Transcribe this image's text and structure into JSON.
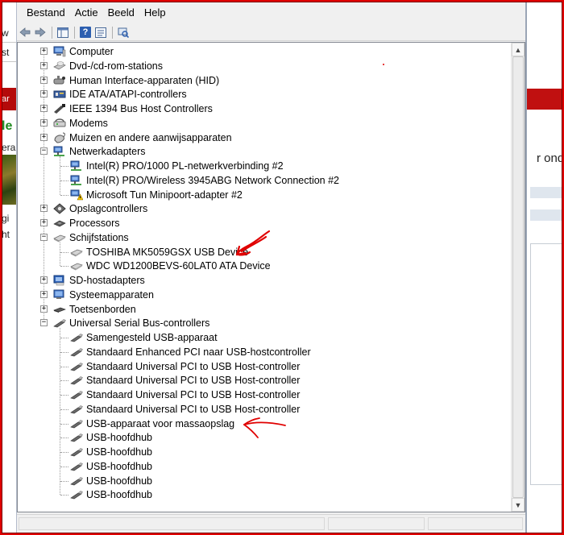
{
  "menu": [
    "Bestand",
    "Actie",
    "Beeld",
    "Help"
  ],
  "toolbar": {
    "buttons": [
      "back-arrow-icon",
      "forward-arrow-icon",
      "console-tree-icon",
      "help-icon",
      "properties-icon",
      "scan-hardware-icon"
    ],
    "help_label": "?"
  },
  "tree": {
    "items": [
      {
        "label": "Computer",
        "level": 1,
        "expander": "+",
        "icon": "computer-icon"
      },
      {
        "label": "Dvd-/cd-rom-stations",
        "level": 1,
        "expander": "+",
        "icon": "dvd-drive-icon"
      },
      {
        "label": "Human Interface-apparaten (HID)",
        "level": 1,
        "expander": "+",
        "icon": "hid-icon"
      },
      {
        "label": "IDE ATA/ATAPI-controllers",
        "level": 1,
        "expander": "+",
        "icon": "ide-controller-icon"
      },
      {
        "label": "IEEE 1394 Bus Host Controllers",
        "level": 1,
        "expander": "+",
        "icon": "ieee1394-icon"
      },
      {
        "label": "Modems",
        "level": 1,
        "expander": "+",
        "icon": "modem-icon"
      },
      {
        "label": "Muizen en andere aanwijsapparaten",
        "level": 1,
        "expander": "+",
        "icon": "mouse-icon"
      },
      {
        "label": "Netwerkadapters",
        "level": 1,
        "expander": "−",
        "icon": "network-adapter-icon"
      },
      {
        "label": "Intel(R) PRO/1000 PL-netwerkverbinding #2",
        "level": 2,
        "icon": "network-adapter-icon"
      },
      {
        "label": "Intel(R) PRO/Wireless 3945ABG Network Connection #2",
        "level": 2,
        "icon": "network-adapter-icon"
      },
      {
        "label": "Microsoft Tun Minipoort-adapter #2",
        "level": 2,
        "icon": "network-warning-icon"
      },
      {
        "label": "Opslagcontrollers",
        "level": 1,
        "expander": "+",
        "icon": "storage-controller-icon"
      },
      {
        "label": "Processors",
        "level": 1,
        "expander": "+",
        "icon": "processor-icon"
      },
      {
        "label": "Schijfstations",
        "level": 1,
        "expander": "−",
        "icon": "disk-drive-icon"
      },
      {
        "label": "TOSHIBA MK5059GSX USB Device",
        "level": 2,
        "icon": "disk-drive-icon"
      },
      {
        "label": "WDC WD1200BEVS-60LAT0 ATA Device",
        "level": 2,
        "icon": "disk-drive-icon"
      },
      {
        "label": "SD-hostadapters",
        "level": 1,
        "expander": "+",
        "icon": "sd-host-icon"
      },
      {
        "label": "Systeemapparaten",
        "level": 1,
        "expander": "+",
        "icon": "system-device-icon"
      },
      {
        "label": "Toetsenborden",
        "level": 1,
        "expander": "+",
        "icon": "keyboard-icon"
      },
      {
        "label": "Universal Serial Bus-controllers",
        "level": 1,
        "expander": "−",
        "icon": "usb-icon"
      },
      {
        "label": "Samengesteld USB-apparaat",
        "level": 2,
        "icon": "usb-icon"
      },
      {
        "label": "Standaard Enhanced PCI naar USB-hostcontroller",
        "level": 2,
        "icon": "usb-icon"
      },
      {
        "label": "Standaard Universal PCI to USB Host-controller",
        "level": 2,
        "icon": "usb-icon"
      },
      {
        "label": "Standaard Universal PCI to USB Host-controller",
        "level": 2,
        "icon": "usb-icon"
      },
      {
        "label": "Standaard Universal PCI to USB Host-controller",
        "level": 2,
        "icon": "usb-icon"
      },
      {
        "label": "Standaard Universal PCI to USB Host-controller",
        "level": 2,
        "icon": "usb-icon"
      },
      {
        "label": "USB-apparaat voor massaopslag",
        "level": 2,
        "icon": "usb-icon"
      },
      {
        "label": "USB-hoofdhub",
        "level": 2,
        "icon": "usb-icon"
      },
      {
        "label": "USB-hoofdhub",
        "level": 2,
        "icon": "usb-icon"
      },
      {
        "label": "USB-hoofdhub",
        "level": 2,
        "icon": "usb-icon"
      },
      {
        "label": "USB-hoofdhub",
        "level": 2,
        "icon": "usb-icon"
      },
      {
        "label": "USB-hoofdhub",
        "level": 2,
        "icon": "usb-icon"
      }
    ]
  },
  "background": {
    "left_fragments": [
      "w",
      "st",
      "ar",
      "le",
      "era",
      "gi",
      "ht"
    ],
    "right_fragment": "r onde"
  },
  "colors": {
    "frame": "#e00000",
    "annotation": "#e00000",
    "menu_bg": "#f0f0f0",
    "tree_bg": "#ffffff",
    "usb_icon": "#4a4a4a"
  }
}
